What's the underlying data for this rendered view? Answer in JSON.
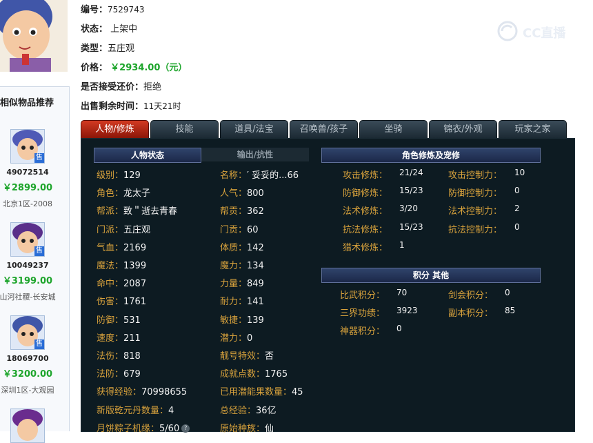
{
  "item": {
    "id_label": "编号：",
    "id_value": "7529743",
    "status_label": "状态：",
    "status_value": "上架中",
    "type_label": "类型：",
    "type_value": "五庄观",
    "price_label": "价格：",
    "price_value": "￥2934.00（元）",
    "bargain_label": "是否接受还价：",
    "bargain_value": "拒绝",
    "remaining_label": "出售剩余时间：",
    "remaining_value": "11天21时"
  },
  "logo": {
    "text": "CC直播"
  },
  "sidebar": {
    "title": "相似物品推荐",
    "items": [
      {
        "id": "49072514",
        "price": "￥2899.00",
        "server": "北京1区-2008",
        "tag": "售"
      },
      {
        "id": "10049237",
        "price": "￥3199.00",
        "server": "山河社稷-长安城",
        "tag": "售"
      },
      {
        "id": "18069700",
        "price": "￥3200.00",
        "server": "深圳1区-大观园",
        "tag": "售"
      }
    ]
  },
  "tabs": [
    "人物/修炼",
    "技能",
    "道具/法宝",
    "召唤兽/孩子",
    "坐骑",
    "锦衣/外观",
    "玩家之家"
  ],
  "left_panel": {
    "header_active": "人物状态",
    "header_inactive": "输出/抗性",
    "col1": [
      {
        "label": "级别：",
        "value": "129"
      },
      {
        "label": "角色：",
        "value": "龙太子"
      },
      {
        "label": "帮派：",
        "value": "致＂逝去青春"
      },
      {
        "label": "门派：",
        "value": "五庄观"
      },
      {
        "label": "气血：",
        "value": "2169"
      },
      {
        "label": "魔法：",
        "value": "1399"
      },
      {
        "label": "命中：",
        "value": "2087"
      },
      {
        "label": "伤害：",
        "value": "1761"
      },
      {
        "label": "防御：",
        "value": "531"
      },
      {
        "label": "速度：",
        "value": "211"
      },
      {
        "label": "法伤：",
        "value": "818"
      },
      {
        "label": "法防：",
        "value": "679"
      },
      {
        "label": "获得经验：",
        "value": "70998655"
      },
      {
        "label": "新版乾元丹数量：",
        "value": "4"
      },
      {
        "label": "月饼粽子机缘：",
        "value": "5/60"
      }
    ],
    "col2": [
      {
        "label": "名称：",
        "value": "′ 妥妥的...66"
      },
      {
        "label": "人气：",
        "value": "800"
      },
      {
        "label": "帮贡：",
        "value": "362"
      },
      {
        "label": "门贡：",
        "value": "60"
      },
      {
        "label": "体质：",
        "value": "142"
      },
      {
        "label": "魔力：",
        "value": "134"
      },
      {
        "label": "力量：",
        "value": "849"
      },
      {
        "label": "耐力：",
        "value": "141"
      },
      {
        "label": "敏捷：",
        "value": "139"
      },
      {
        "label": "潜力：",
        "value": "0"
      },
      {
        "label": "靓号特效：",
        "value": "否"
      },
      {
        "label": "成就点数：",
        "value": "1765"
      },
      {
        "label": "已用潜能果数量：",
        "value": "45"
      },
      {
        "label": "总经验：",
        "value": "36亿"
      },
      {
        "label": "原始种族：",
        "value": "仙"
      }
    ]
  },
  "right_panel": {
    "cultivation_header": "角色修炼及宠修",
    "cultivation": [
      {
        "label": "攻击修炼：",
        "value": "21/24",
        "label2": "攻击控制力：",
        "value2": "10"
      },
      {
        "label": "防御修炼：",
        "value": "15/23",
        "label2": "防御控制力：",
        "value2": "0"
      },
      {
        "label": "法术修炼：",
        "value": "3/20",
        "label2": "法术控制力：",
        "value2": "2"
      },
      {
        "label": "抗法修炼：",
        "value": "15/23",
        "label2": "抗法控制力：",
        "value2": "0"
      },
      {
        "label": "猎术修炼：",
        "value": "1"
      }
    ],
    "points_header": "积分 其他",
    "points": [
      {
        "label": "比武积分：",
        "value": "70",
        "label2": "剑会积分：",
        "value2": "0"
      },
      {
        "label": "三界功绩：",
        "value": "3923",
        "label2": "副本积分：",
        "value2": "85"
      },
      {
        "label": "神器积分：",
        "value": "0"
      }
    ]
  }
}
